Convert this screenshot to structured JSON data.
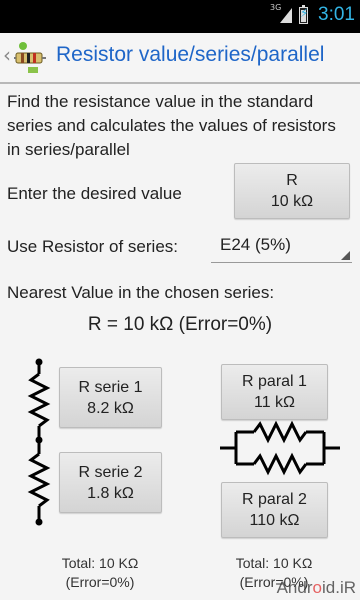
{
  "status_bar": {
    "network": "3G",
    "time": "3:01"
  },
  "app": {
    "title": "Resistor value/series/parallel"
  },
  "description": "Find the resistance value in the standard series and calculates the values of resistors in series/parallel",
  "desired": {
    "label": "Enter the desired value",
    "button_line1": "R",
    "button_line2": "10 kΩ"
  },
  "series": {
    "label": "Use Resistor of series:",
    "selected": "E24 (5%)"
  },
  "nearest": {
    "label": "Nearest Value in the chosen series:",
    "result": "R = 10 kΩ  (Error=0%)"
  },
  "series_circuit": {
    "r1_title": "R serie 1",
    "r1_value": "8.2 kΩ",
    "r2_title": "R serie 2",
    "r2_value": "1.8 kΩ",
    "total": "Total: 10 KΩ",
    "error": "(Error=0%)"
  },
  "parallel_circuit": {
    "r1_title": "R paral 1",
    "r1_value": "11 kΩ",
    "r2_title": "R paral 2",
    "r2_value": "110 kΩ",
    "total": "Total: 10 KΩ",
    "error": "(Error=0%)"
  },
  "watermark": {
    "prefix": "Andr",
    "dot": "o",
    "suffix": "id.iR"
  },
  "colors": {
    "accent": "#33b5e5",
    "title": "#1f66c8"
  }
}
